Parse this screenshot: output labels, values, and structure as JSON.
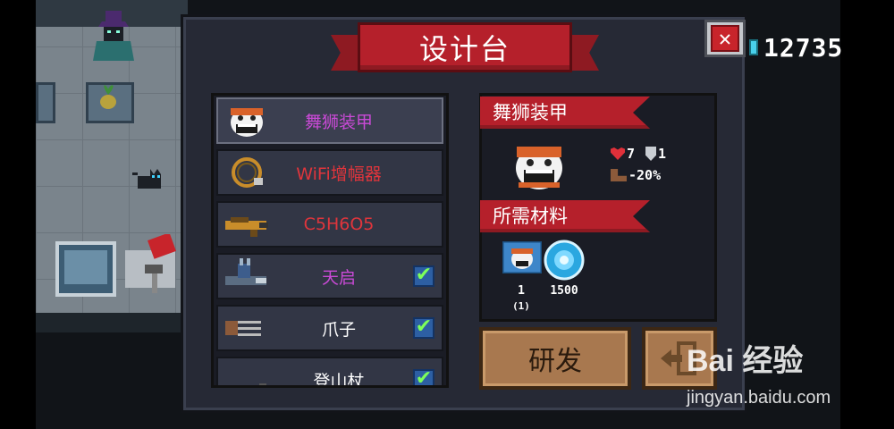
{
  "title": "设计台",
  "close_label": "✕",
  "coins": "12735",
  "items": [
    {
      "name": "舞狮装甲",
      "color": "#c94ad6",
      "icon": "lion-dance-armor-icon",
      "checked": false,
      "selected": true
    },
    {
      "name": "WiFi增幅器",
      "color": "#e0353c",
      "icon": "wifi-amplifier-icon",
      "checked": false,
      "selected": false
    },
    {
      "name": "C5H6O5",
      "color": "#e0353c",
      "icon": "c5h6o5-weapon-icon",
      "checked": false,
      "selected": false
    },
    {
      "name": "天启",
      "color": "#c94ad6",
      "icon": "apocalypse-icon",
      "checked": true,
      "selected": false
    },
    {
      "name": "爪子",
      "color": "#ffffff",
      "icon": "claw-icon",
      "checked": true,
      "selected": false
    },
    {
      "name": "登山杖",
      "color": "#ffffff",
      "icon": "hiking-stick-icon",
      "checked": true,
      "selected": false
    }
  ],
  "checkmark": "✔",
  "detail": {
    "name": "舞狮装甲",
    "hp": "7",
    "armor": "1",
    "speed": "-20%",
    "materials_title": "所需材料",
    "materials": [
      {
        "icon": "lion-blueprint-icon",
        "count": "1",
        "sub": "(1)"
      },
      {
        "icon": "gem-icon",
        "count": "1500",
        "sub": ""
      }
    ]
  },
  "research_label": "研发",
  "watermark": {
    "logo": "Bai 经验",
    "url": "jingyan.baidu.com"
  },
  "colors": {
    "banner": "#b5202b",
    "panel": "#262935",
    "button": "#a8784f"
  }
}
